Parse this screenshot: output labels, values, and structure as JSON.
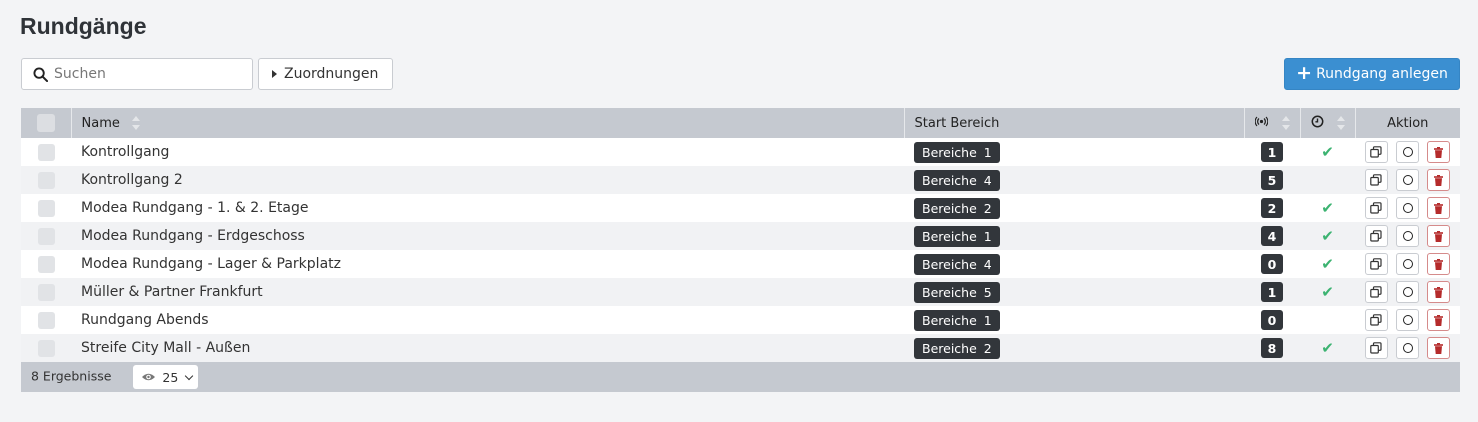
{
  "page": {
    "title": "Rundgänge"
  },
  "toolbar": {
    "search_placeholder": "Suchen",
    "assign_label": "Zuordnungen",
    "add_label": "Rundgang anlegen"
  },
  "table": {
    "columns": {
      "name": "Name",
      "start": "Start Bereich",
      "sensor_icon": "broadcast-icon",
      "time_icon": "clock-icon",
      "action": "Aktion"
    },
    "rows": [
      {
        "name": "Kontrollgang",
        "bereich_label": "Bereiche",
        "bereich_count": "1",
        "count": "1",
        "active": true
      },
      {
        "name": "Kontrollgang 2",
        "bereich_label": "Bereiche",
        "bereich_count": "4",
        "count": "5",
        "active": false
      },
      {
        "name": "Modea Rundgang - 1. & 2. Etage",
        "bereich_label": "Bereiche",
        "bereich_count": "2",
        "count": "2",
        "active": true
      },
      {
        "name": "Modea Rundgang - Erdgeschoss",
        "bereich_label": "Bereiche",
        "bereich_count": "1",
        "count": "4",
        "active": true
      },
      {
        "name": "Modea Rundgang - Lager & Parkplatz",
        "bereich_label": "Bereiche",
        "bereich_count": "4",
        "count": "0",
        "active": true
      },
      {
        "name": "Müller & Partner Frankfurt",
        "bereich_label": "Bereiche",
        "bereich_count": "5",
        "count": "1",
        "active": true
      },
      {
        "name": "Rundgang Abends",
        "bereich_label": "Bereiche",
        "bereich_count": "1",
        "count": "0",
        "active": false
      },
      {
        "name": "Streife City Mall - Außen",
        "bereich_label": "Bereiche",
        "bereich_count": "2",
        "count": "8",
        "active": true
      }
    ],
    "check_glyph": "✔"
  },
  "footer": {
    "results_text": "8 Ergebnisse",
    "page_size": "25"
  },
  "colors": {
    "accent": "#3b8fd1",
    "header_bg": "#c5c9d0",
    "badge_bg": "#32363b",
    "check": "#3cb371",
    "delete": "#b52b2b"
  }
}
